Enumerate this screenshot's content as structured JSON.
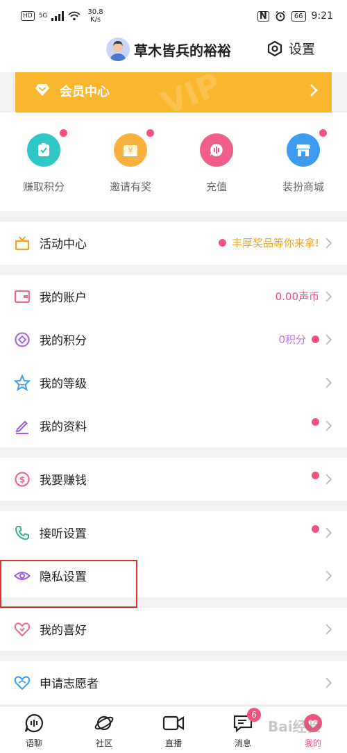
{
  "status_bar": {
    "hd": "HD",
    "network": "5G",
    "speed_value": "30.8",
    "speed_unit": "K/s",
    "battery": "66",
    "time": "9:21"
  },
  "header": {
    "username": "草木皆兵的裕裕",
    "settings_label": "设置"
  },
  "vip_banner": {
    "label": "会员中心",
    "watermark": "VIP"
  },
  "quick_actions": [
    {
      "label": "赚取积分",
      "color": "#2fc6c6"
    },
    {
      "label": "邀请有奖",
      "color": "#f6b13e"
    },
    {
      "label": "充值",
      "color": "#f25e8a"
    },
    {
      "label": "装扮商城",
      "color": "#3d9bf0"
    }
  ],
  "activity": {
    "label": "活动中心",
    "promo": "丰厚奖品等你来拿!"
  },
  "account_section": {
    "account": {
      "label": "我的账户",
      "value": "0.00声币"
    },
    "points": {
      "label": "我的积分",
      "value": "0积分"
    },
    "level": {
      "label": "我的等级"
    },
    "profile": {
      "label": "我的资料"
    }
  },
  "earn": {
    "label": "我要赚钱"
  },
  "settings_section": {
    "answer": {
      "label": "接听设置"
    },
    "privacy": {
      "label": "隐私设置"
    }
  },
  "hobby": {
    "label": "我的喜好"
  },
  "volunteer": {
    "label": "申请志愿者"
  },
  "bottom_nav": {
    "items": [
      {
        "label": "语聊"
      },
      {
        "label": "社区"
      },
      {
        "label": "直播"
      },
      {
        "label": "消息",
        "badge": "6"
      },
      {
        "label": "我的"
      }
    ]
  },
  "watermark": "Bai经验",
  "colors": {
    "accent_pink": "#f2527e",
    "vip_orange": "#fbb630",
    "promo_text": "#f0a41a",
    "coin_text": "#e8507d",
    "points_text": "#b877e6",
    "highlight_box": "#d9352f"
  }
}
